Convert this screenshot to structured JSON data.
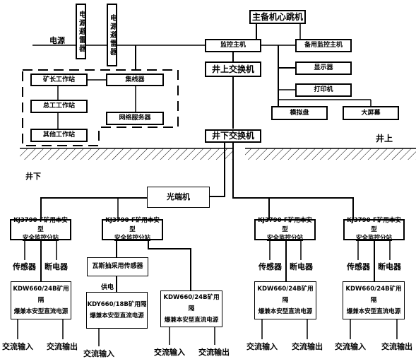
{
  "labels": {
    "power": "电源",
    "surface": "井上",
    "underground": "井下",
    "power_supply": "供电"
  },
  "surface": {
    "lightning1": "电源避雷器",
    "lightning2": "电源避雷器",
    "heartbeat": "主备机心跳机",
    "monitor_host": "监控主机",
    "backup_host": "备用监控主机",
    "display": "显示器",
    "printer": "打印机",
    "simulator_panel": "模拟盘",
    "big_screen": "大屏幕",
    "surface_switch": "井上交换机",
    "office": {
      "mine_manager": "矿长工作站",
      "chief_engineer": "总工工作站",
      "other": "其他工作站",
      "hub": "集线器",
      "network_server": "网络服务器"
    }
  },
  "underground": {
    "underground_switch": "井下交换机",
    "optical_transceiver": "光端机",
    "gas_sensor": "瓦斯抽采用传感器",
    "stations": [
      {
        "line1": "KJ3790-F矿用本安型",
        "line2": "安全监控分站",
        "sensor": "传感器",
        "breaker": "断电器"
      },
      {
        "line1": "KJ3790-F矿用本安型",
        "line2": "安全监控分站"
      },
      {
        "line1": "KJ3790-F矿用本安型",
        "line2": "安全监控分站",
        "sensor": "传感器",
        "breaker": "断电器"
      },
      {
        "line1": "KJ3790-F矿用本安型",
        "line2": "安全监控分站",
        "sensor": "传感器",
        "breaker": "断电器"
      }
    ],
    "psus": [
      {
        "line1": "KDW660/24B矿用隔",
        "line2": "爆兼本安型直流电源",
        "input": "交流输入",
        "output": "交流输出"
      },
      {
        "line1": "KDY660/18B矿用隔",
        "line2": "爆兼本安型直流电源",
        "input": "交流输入"
      },
      {
        "line1": "KDW660/24B矿用隔",
        "line2": "爆兼本安型直流电源",
        "input": "交流输入",
        "output": "交流输出"
      },
      {
        "line1": "KDW660/24B矿用隔",
        "line2": "爆兼本安型直流电源",
        "input": "交流输入",
        "output": "交流输出"
      },
      {
        "line1": "KDW660/24B矿用隔",
        "line2": "爆兼本安型直流电源",
        "input": "交流输入",
        "output": "交流输出"
      }
    ]
  }
}
